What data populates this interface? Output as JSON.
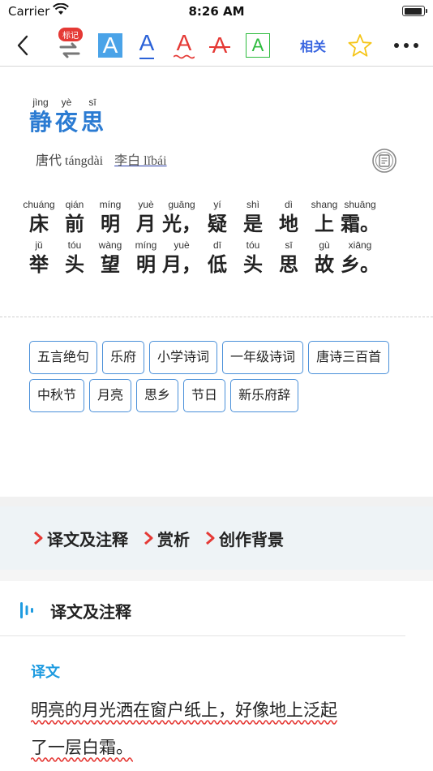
{
  "status": {
    "carrier": "Carrier",
    "time": "8:26 AM"
  },
  "toolbar": {
    "badge": "标记",
    "font_letter": "A",
    "related_label": "相关"
  },
  "poem": {
    "title": [
      {
        "py": "jìng",
        "hz": "静"
      },
      {
        "py": "yè",
        "hz": "夜"
      },
      {
        "py": "sī",
        "hz": "思"
      }
    ],
    "dynasty": "唐代",
    "dynasty_py": "tángdài",
    "author": "李白 lĭbái",
    "lines": [
      [
        {
          "py": "chuáng",
          "hz": "床"
        },
        {
          "py": "qián",
          "hz": "前"
        },
        {
          "py": "míng",
          "hz": "明"
        },
        {
          "py": "yuè",
          "hz": "月"
        },
        {
          "py": "guāng",
          "hz": "光，"
        },
        {
          "py": "yí",
          "hz": "疑"
        },
        {
          "py": "shì",
          "hz": "是"
        },
        {
          "py": "dì",
          "hz": "地"
        },
        {
          "py": "shang",
          "hz": "上"
        },
        {
          "py": "shuāng",
          "hz": "霜。"
        }
      ],
      [
        {
          "py": "jǔ",
          "hz": "举"
        },
        {
          "py": "tóu",
          "hz": "头"
        },
        {
          "py": "wàng",
          "hz": "望"
        },
        {
          "py": "míng",
          "hz": "明"
        },
        {
          "py": "yuè",
          "hz": "月，"
        },
        {
          "py": "dī",
          "hz": "低"
        },
        {
          "py": "tóu",
          "hz": "头"
        },
        {
          "py": "sī",
          "hz": "思"
        },
        {
          "py": "gù",
          "hz": "故"
        },
        {
          "py": "xiāng",
          "hz": "乡。"
        }
      ]
    ]
  },
  "tags": [
    "五言绝句",
    "乐府",
    "小学诗词",
    "一年级诗词",
    "唐诗三百首",
    "中秋节",
    "月亮",
    "思乡",
    "节日",
    "新乐府辞"
  ],
  "nav": [
    "译文及注释",
    "赏析",
    "创作背景"
  ],
  "section": {
    "title": "译文及注释",
    "sub_label": "译文",
    "translation_lines": [
      "明亮的月光洒在窗户纸上，好像地上泛起",
      "了一层白霜。"
    ]
  },
  "colors": {
    "accent": "#2b7bd2",
    "tag_border": "#4a90d9",
    "nav_arrow": "#e53935",
    "wavy": "#e53935",
    "star": "#f5c518"
  }
}
